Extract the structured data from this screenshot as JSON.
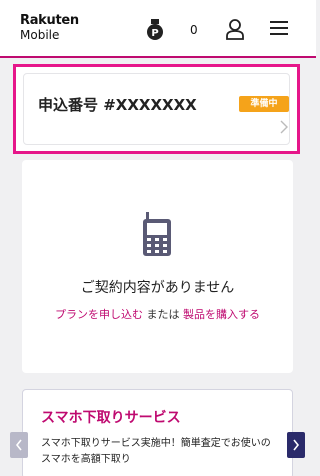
{
  "header": {
    "logo_top": "Rakuten",
    "logo_bottom": "Mobile",
    "points_count": "0",
    "points_icon": "points-badge-icon",
    "user_icon": "user-icon",
    "menu_icon": "hamburger-menu-icon"
  },
  "order": {
    "title": "申込番号 #XXXXXXX",
    "status": "準備中",
    "chevron_icon": "chevron-right-icon"
  },
  "contract": {
    "icon": "mobile-phone-icon",
    "message": "ご契約内容がありません",
    "link_apply": "プランを申し込む",
    "connector": "または",
    "link_purchase": "製品を購入する"
  },
  "trade_in": {
    "title": "スマホ下取りサービス",
    "description": "スマホ下取りサービス実施中！簡単査定でお使いのスマホを高額下取り"
  },
  "carousel": {
    "prev_icon": "chevron-left-icon",
    "next_icon": "chevron-right-icon"
  },
  "colors": {
    "brand": "#bf0a70",
    "highlight_border": "#e6168a",
    "status_badge": "#f5a31a",
    "carousel_active": "#2a2a6a"
  }
}
